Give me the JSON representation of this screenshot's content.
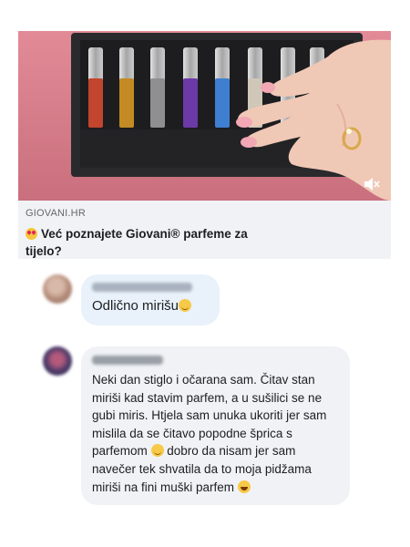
{
  "link_preview": {
    "source": "GIOVANI.HR",
    "headline": "Već poznajete Giovani® parfeme za tijelo?",
    "emoji_icon": "heart-eyes-emoji-icon",
    "mute_icon": "muted-speaker-icon"
  },
  "comments": [
    {
      "author_blurred": true,
      "text": "Odlično mirišu",
      "emoji": "wink-emoji-icon"
    },
    {
      "author_blurred": true,
      "text_part1": "Neki dan stiglo i očarana sam. Čitav stan miriši kad stavim parfem, a u sušilici se ne gubi miris. Htjela sam unuka ukoriti jer sam mislila da se čitavo popodne šprica s parfemom ",
      "text_part2": " dobro da nisam jer sam navečer tek shvatila da to moja pidžama miriši na fini muški parfem ",
      "emoji1": "slightly-smiling-emoji-icon",
      "emoji2": "tears-of-joy-emoji-icon"
    }
  ],
  "colors": {
    "video_background": "#d9828e",
    "card_background": "#f0f2f5",
    "highlight_bubble": "#e9f2fb"
  }
}
